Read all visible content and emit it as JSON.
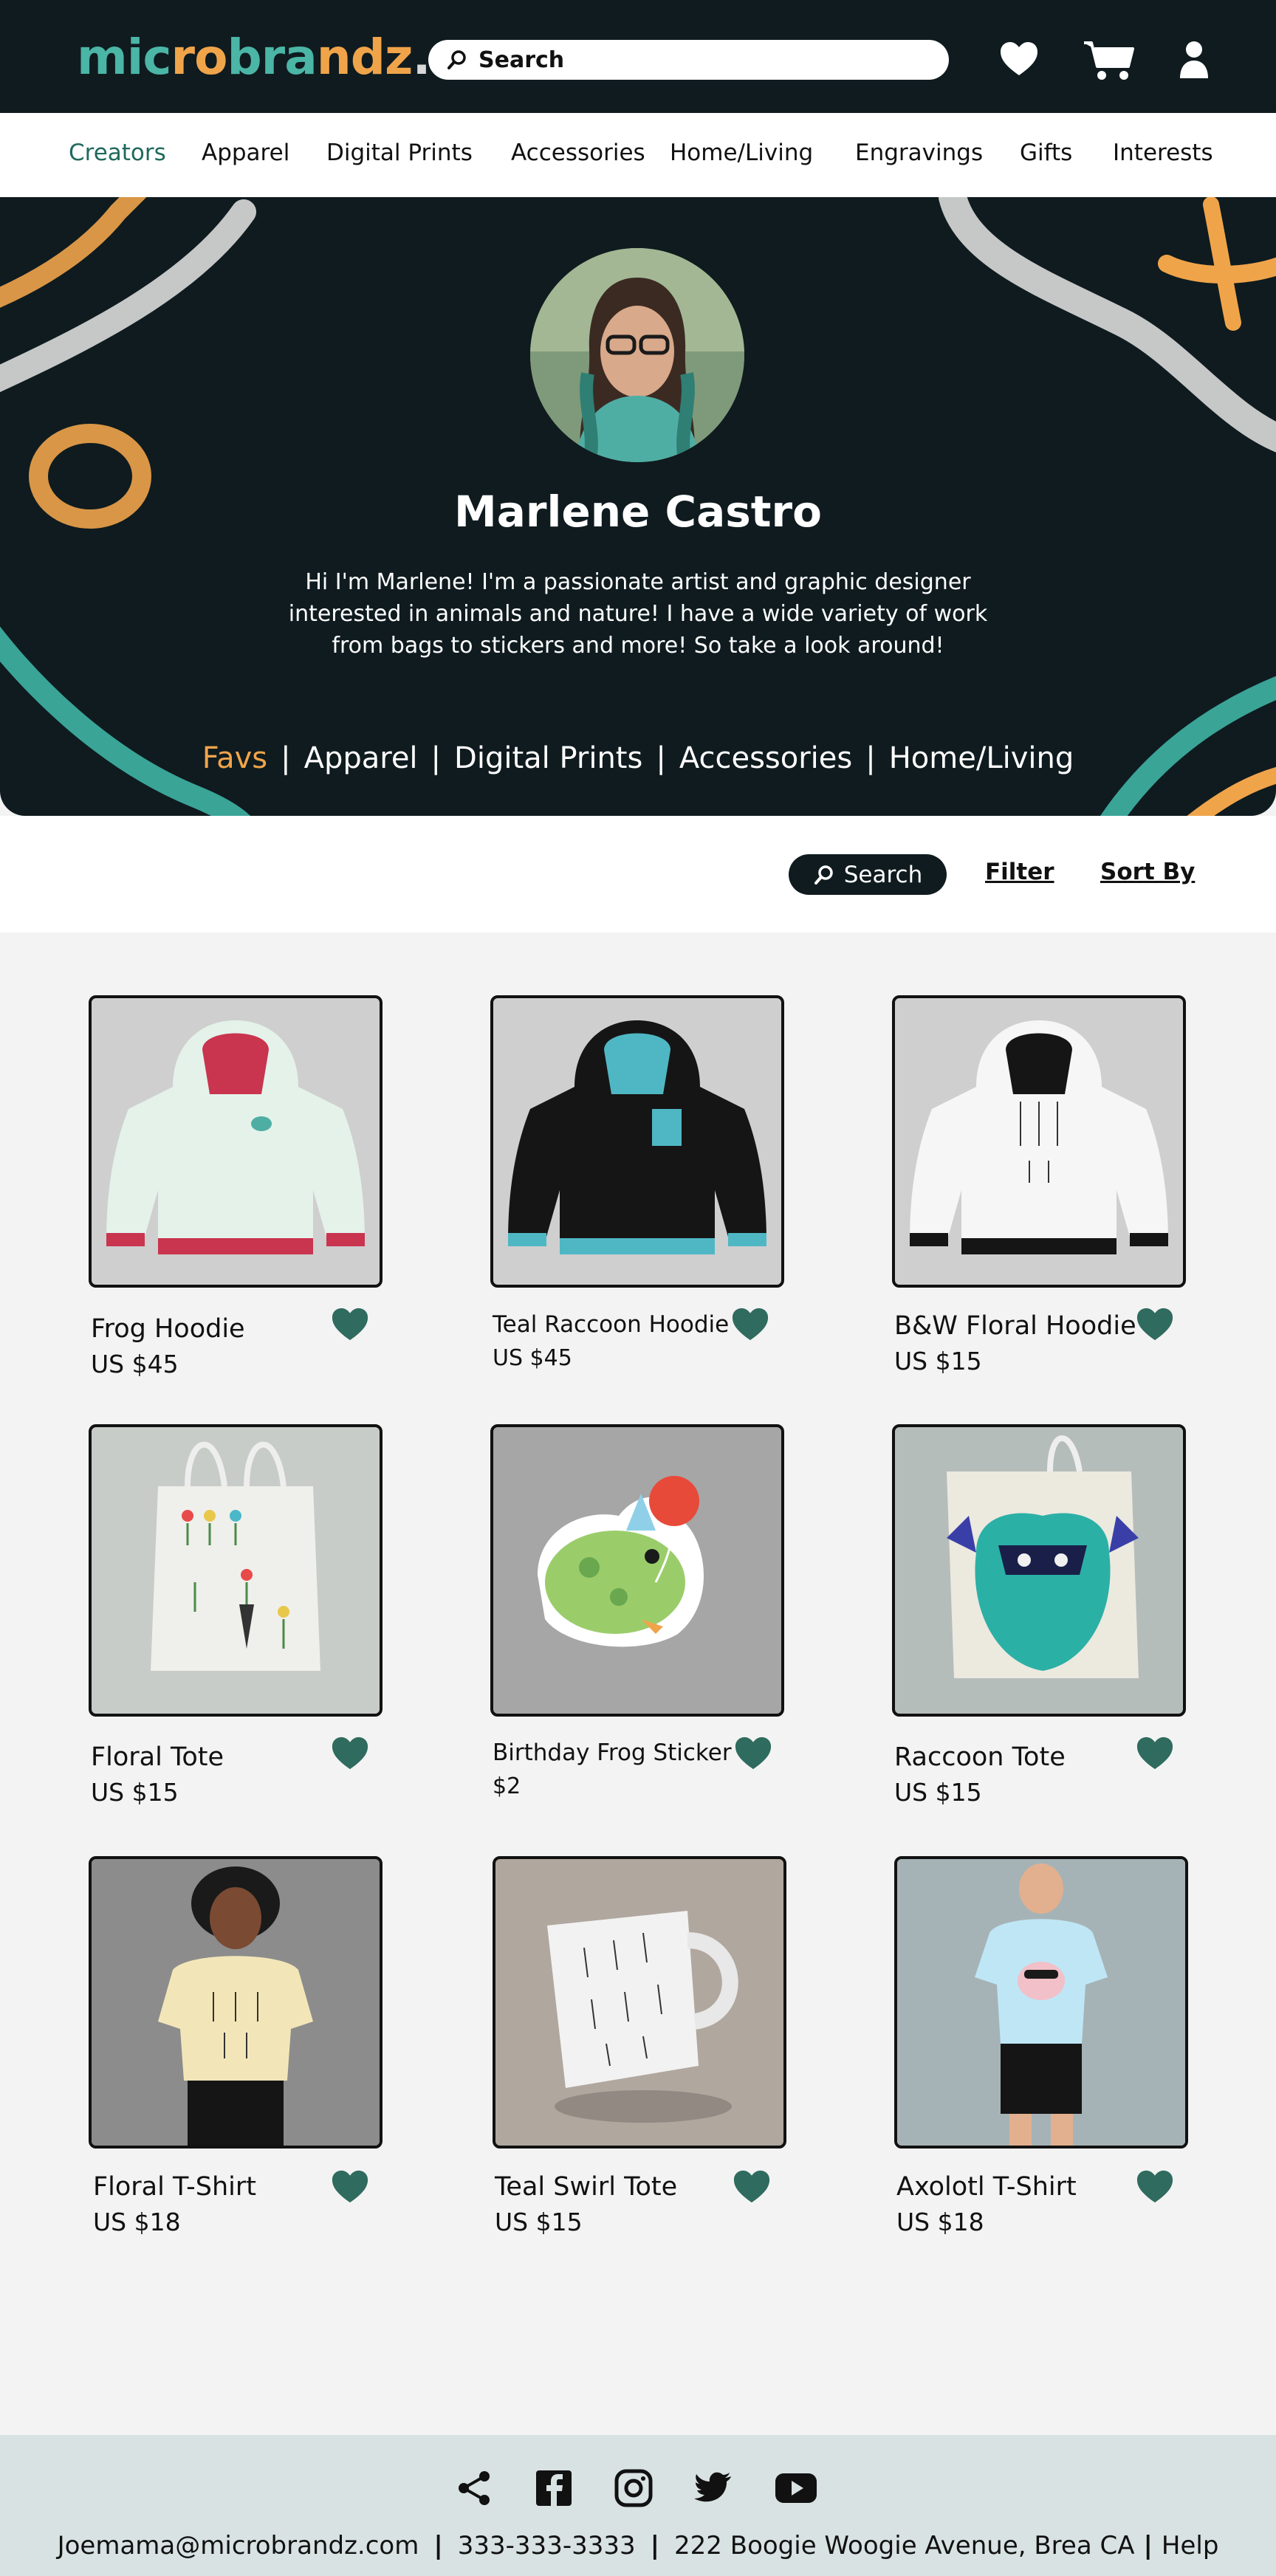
{
  "header": {
    "logo": {
      "part1": "mic",
      "part2": "ro",
      "part3": "bra",
      "part4": "ndz",
      "part5": "."
    },
    "search_label": "Search"
  },
  "nav": {
    "items": [
      "Creators",
      "Apparel",
      "Digital Prints",
      "Accessories",
      "Home/Living",
      "Engravings",
      "Gifts",
      "Interests"
    ]
  },
  "profile": {
    "name": "Marlene Castro",
    "bio": "Hi I'm Marlene! I'm a passionate artist and graphic designer interested in animals and nature! I have a wide variety of work from bags to stickers and more! So take a look around!",
    "tabs": [
      "Favs",
      "Apparel",
      "Digital Prints",
      "Accessories",
      "Home/Living"
    ],
    "tab_separator": "|"
  },
  "toolbar": {
    "search_label": "Search",
    "filter_label": "Filter",
    "sort_label": "Sort By"
  },
  "products": [
    {
      "name": "Frog Hoodie",
      "price": "US $45"
    },
    {
      "name": "Teal Raccoon Hoodie",
      "price": "US $45"
    },
    {
      "name": "B&W Floral Hoodie",
      "price": "US $15"
    },
    {
      "name": "Floral Tote",
      "price": "US $15"
    },
    {
      "name": "Birthday Frog Sticker",
      "price": "$2"
    },
    {
      "name": "Raccoon Tote",
      "price": "US $15"
    },
    {
      "name": "Floral T-Shirt",
      "price": "US $18"
    },
    {
      "name": "Teal Swirl Tote",
      "price": "US $15"
    },
    {
      "name": "Axolotl T-Shirt",
      "price": "US $18"
    }
  ],
  "footer": {
    "email": "Joemama@microbrandz.com",
    "phone": "333-333-3333",
    "address": "222 Boogie Woogie Avenue, Brea CA",
    "help": "Help",
    "separator": "|",
    "social_icons": [
      "share-icon",
      "facebook-icon",
      "instagram-icon",
      "twitter-icon",
      "youtube-icon"
    ]
  },
  "colors": {
    "dark": "#0f1b1f",
    "teal": "#4bb5a6",
    "orange": "#f0a44a",
    "heart": "#2f6b5e"
  }
}
